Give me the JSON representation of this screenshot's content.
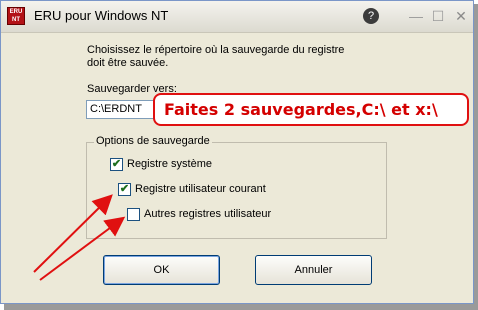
{
  "window": {
    "title": "ERU pour Windows NT",
    "app_icon_text": "ERU NT",
    "help_icon": "?",
    "minimize_glyph": "—",
    "maximize_glyph": "☐",
    "close_glyph": "✕"
  },
  "instructions": {
    "line1": "Choisissez le répertoire où la sauvegarde du registre",
    "line2": "doit être sauvée."
  },
  "save_to": {
    "label": "Sauvegarder vers:",
    "value": "C:\\ERDNT"
  },
  "callout": {
    "text": "Faites 2 sauvegardes,C:\\ et x:\\",
    "color": "#d40000"
  },
  "options": {
    "group_title": "Options de sauvegarde",
    "items": [
      {
        "label": "Registre système",
        "checked": true
      },
      {
        "label": "Registre utilisateur courant",
        "checked": true
      },
      {
        "label": "Autres registres utilisateur",
        "checked": false
      }
    ]
  },
  "buttons": {
    "ok": "OK",
    "cancel": "Annuler"
  },
  "colors": {
    "dialog_bg": "#ece9d8",
    "arrow": "#e01010"
  }
}
